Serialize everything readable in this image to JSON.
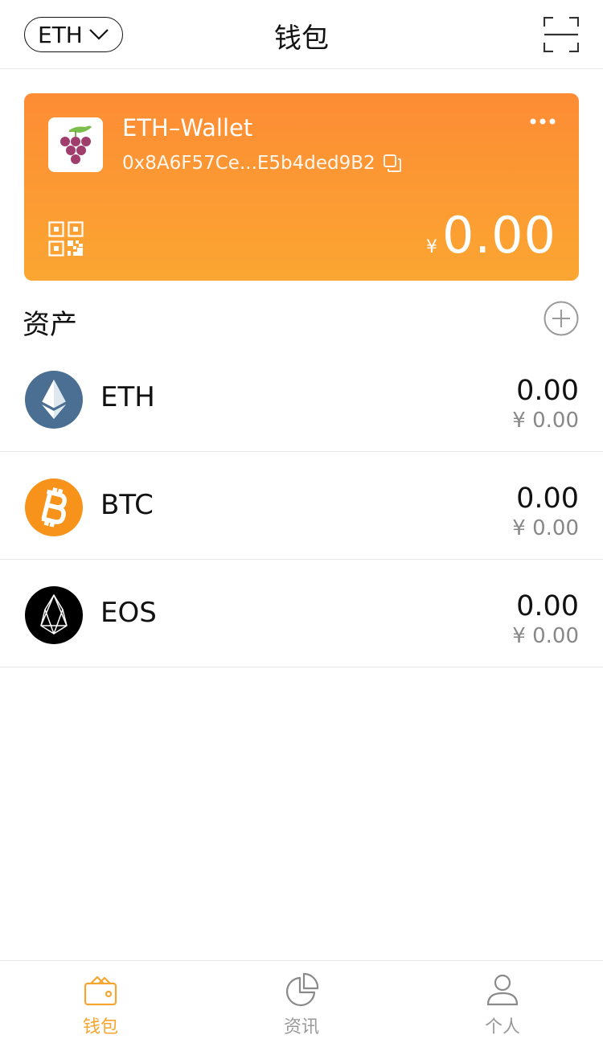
{
  "header": {
    "chain_label": "ETH",
    "title": "钱包"
  },
  "wallet": {
    "name": "ETH–Wallet",
    "address": "0x8A6F57Ce...E5b4ded9B2",
    "currency_symbol": "¥",
    "balance": "0.00"
  },
  "assets": {
    "title": "资产",
    "items": [
      {
        "symbol": "ETH",
        "amount": "0.00",
        "value": "¥ 0.00",
        "icon": "eth-icon"
      },
      {
        "symbol": "BTC",
        "amount": "0.00",
        "value": "¥ 0.00",
        "icon": "btc-icon"
      },
      {
        "symbol": "EOS",
        "amount": "0.00",
        "value": "¥ 0.00",
        "icon": "eos-icon"
      }
    ]
  },
  "tabs": [
    {
      "label": "钱包",
      "icon": "wallet-icon",
      "active": true
    },
    {
      "label": "资讯",
      "icon": "pie-chart-icon",
      "active": false
    },
    {
      "label": "个人",
      "icon": "person-icon",
      "active": false
    }
  ],
  "colors": {
    "card_start": "#fd8c34",
    "card_end": "#fba632",
    "accent": "#f7a531",
    "eth": "#4a6f92",
    "btc": "#f7931a",
    "eos": "#000000"
  }
}
